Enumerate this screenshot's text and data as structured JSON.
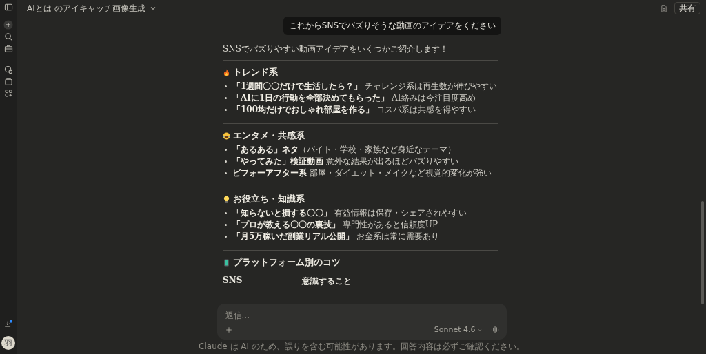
{
  "header": {
    "title": "AIとは のアイキャッチ画像生成",
    "share_button": "共有"
  },
  "sidebar": {
    "avatar": "羽",
    "download_badge": true
  },
  "user_message": "これからSNSでバズりそうな動画のアイデアをください",
  "intro": "SNSでバズりやすい動画アイデアをいくつかご紹介します！",
  "sections": [
    {
      "heading": "トレンド系",
      "items": [
        "**「1週間〇〇だけで生活したら？」** チャレンジ系は再生数が伸びやすい",
        "**「AIに1日の行動を全部決めてもらった」** AI絡みは今注目度高め",
        "**「100均だけでおしゃれ部屋を作る」** コスパ系は共感を得やすい"
      ]
    },
    {
      "heading": "エンタメ・共感系",
      "items": [
        "**「あるある」ネタ**（バイト・学校・家族など身近なテーマ）",
        "**「やってみた」検証動画** 意外な結果が出るほどバズりやすい",
        "**ビフォーアフター系** 部屋・ダイエット・メイクなど視覚的変化が強い"
      ]
    },
    {
      "heading": "お役立ち・知識系",
      "items": [
        "**「知らないと損する〇〇」** 有益情報は保存・シェアされやすい",
        "**「プロが教える〇〇の裏技」** 専門性があると信頼度UP",
        "**「月5万稼いだ副業リアル公開」** お金系は常に需要あり"
      ]
    },
    {
      "heading": "プラットフォーム別のコツ",
      "table_columns": [
        "SNS",
        "意識すること"
      ]
    }
  ],
  "composer": {
    "placeholder": "返信...",
    "model": "Sonnet 4.6"
  },
  "disclaimer": "Claude は AI のため、誤りを含む可能性があります。回答内容は必ずご確認ください。"
}
